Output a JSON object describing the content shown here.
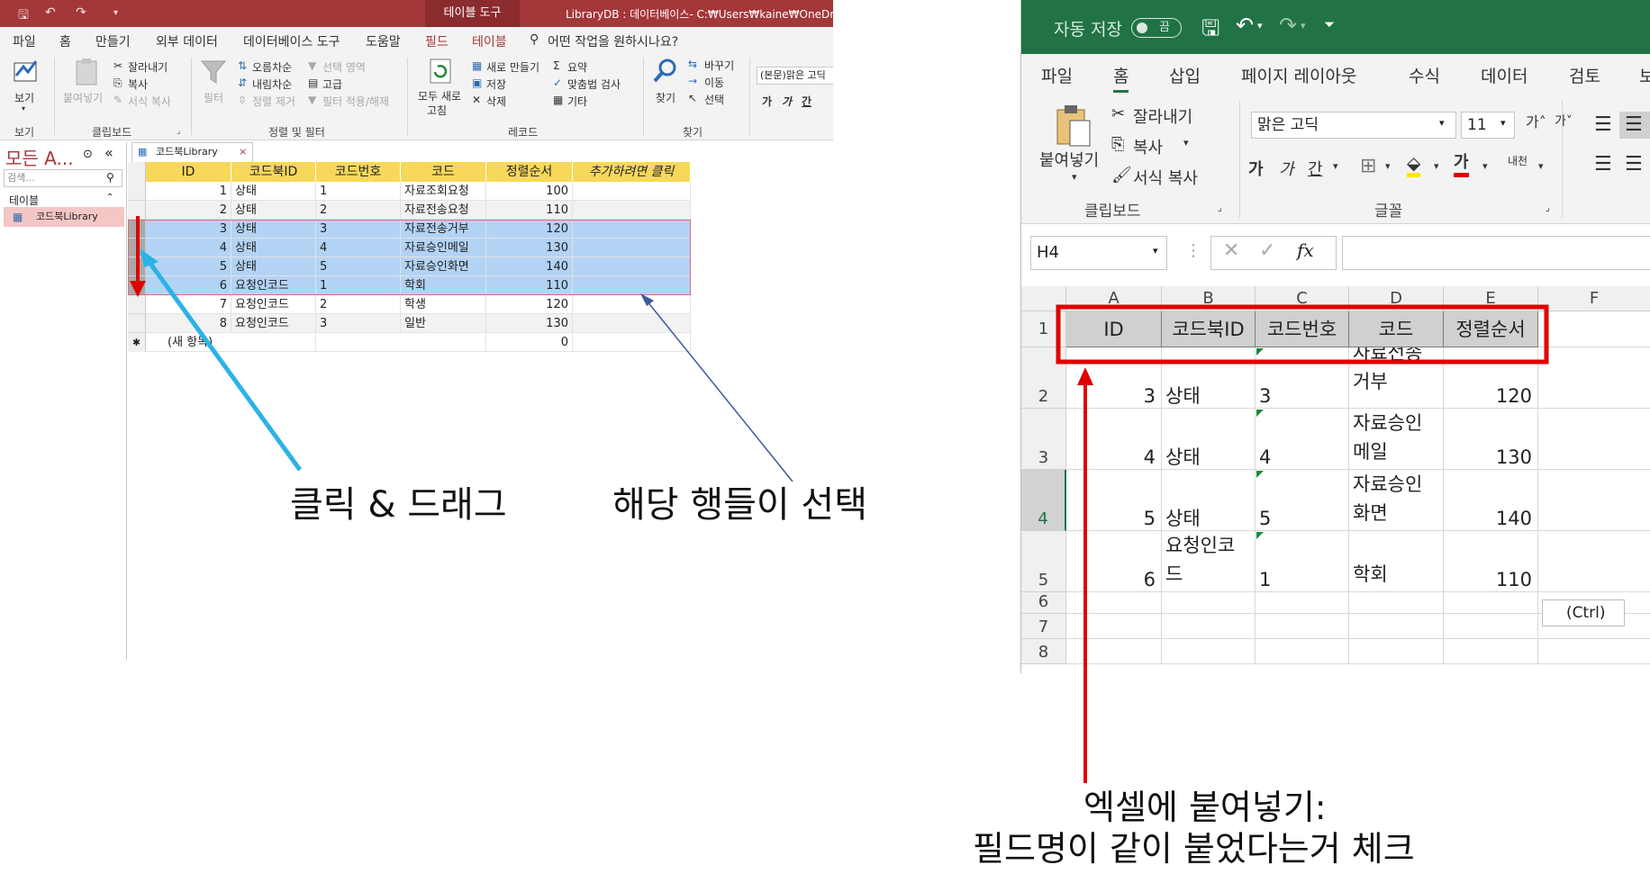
{
  "access": {
    "title": {
      "context_tab": "테이블 도구",
      "document": "LibraryDB : 데이터베이스- C:₩Users₩kaine₩OneDrive₩"
    },
    "tabs": [
      "파일",
      "홈",
      "만들기",
      "외부 데이터",
      "데이터베이스 도구",
      "도움말",
      "필드",
      "테이블"
    ],
    "tell_me": "어떤 작업을 원하시나요?",
    "ribbon": {
      "view": "보기",
      "paste": "붙여넣기",
      "cut": "잘라내기",
      "copy": "복사",
      "format_painter": "서식 복사",
      "filter": "필터",
      "ascending": "오름차순",
      "descending": "내림차순",
      "remove_sort": "정렬 제거",
      "selection": "선택 영역",
      "advanced": "고급",
      "toggle_filter": "필터 적용/해제",
      "refresh_all": "모두 새로",
      "refresh_all2": "고침",
      "new": "새로 만들기",
      "save": "저장",
      "delete": "삭제",
      "totals": "요약",
      "spelling": "맞춤법 검사",
      "more": "기타",
      "find": "찾기",
      "replace": "바꾸기",
      "goto": "이동",
      "select": "선택",
      "font": "(본문)맑은 고딕",
      "group_view": "보기",
      "group_clipboard": "클립보드",
      "group_sort": "정렬 및 필터",
      "group_records": "레코드",
      "group_find": "찾기"
    },
    "nav": {
      "title": "모든 A...",
      "search_placeholder": "검색...",
      "section": "테이블",
      "item": "코드북Library"
    },
    "doc_tab": "코드북Library",
    "columns": [
      "ID",
      "코드북ID",
      "코드번호",
      "코드",
      "정렬순서",
      "추가하려면 클릭"
    ],
    "rows": [
      {
        "id": "1",
        "codebook": "상태",
        "num": "1",
        "code": "자료조회요청",
        "order": "100"
      },
      {
        "id": "2",
        "codebook": "상태",
        "num": "2",
        "code": "자료전송요청",
        "order": "110"
      },
      {
        "id": "3",
        "codebook": "상태",
        "num": "3",
        "code": "자료전송거부",
        "order": "120"
      },
      {
        "id": "4",
        "codebook": "상태",
        "num": "4",
        "code": "자료승인메일",
        "order": "130"
      },
      {
        "id": "5",
        "codebook": "상태",
        "num": "5",
        "code": "자료승인화면",
        "order": "140"
      },
      {
        "id": "6",
        "codebook": "요청인코드",
        "num": "1",
        "code": "학회",
        "order": "110"
      },
      {
        "id": "7",
        "codebook": "요청인코드",
        "num": "2",
        "code": "학생",
        "order": "120"
      },
      {
        "id": "8",
        "codebook": "요청인코드",
        "num": "3",
        "code": "일반",
        "order": "130"
      }
    ],
    "new_row_label": "(새 항목)",
    "new_row_marker": "✱",
    "new_row_order": "0"
  },
  "excel": {
    "autosave": "자동 저장",
    "autosave_state": "끔",
    "tabs": [
      "파일",
      "홈",
      "삽입",
      "페이지 레이아웃",
      "수식",
      "데이터",
      "검토",
      "보"
    ],
    "ribbon": {
      "paste": "붙여넣기",
      "cut": "잘라내기",
      "copy": "복사",
      "format_painter": "서식 복사",
      "font_name": "맑은 고딕",
      "font_size": "11",
      "bold": "가",
      "italic": "가",
      "underline": "간",
      "phonetic": "내천",
      "group_clipboard": "클립보드",
      "group_font": "글꼴"
    },
    "name_box": "H4",
    "fx": "fx",
    "columns": [
      "A",
      "B",
      "C",
      "D",
      "E",
      "F"
    ],
    "row_numbers": [
      "1",
      "2",
      "3",
      "4",
      "5",
      "6",
      "7",
      "8"
    ],
    "header_row": [
      "ID",
      "코드북ID",
      "코드번호",
      "코드",
      "정렬순서"
    ],
    "rows": [
      {
        "id": "3",
        "codebook": "상태",
        "num": "3",
        "code_l1": "자료전송",
        "code_l2": "거부",
        "order": "120"
      },
      {
        "id": "4",
        "codebook": "상태",
        "num": "4",
        "code_l1": "자료승인",
        "code_l2": "메일",
        "order": "130"
      },
      {
        "id": "5",
        "codebook": "상태",
        "num": "5",
        "code_l1": "자료승인",
        "code_l2": "화면",
        "order": "140"
      },
      {
        "id": "6",
        "codebook_l1": "요청인코",
        "codebook_l2": "드",
        "num": "1",
        "code_l1": "",
        "code_l2": "학회",
        "order": "110"
      }
    ],
    "paste_options": "(Ctrl)"
  },
  "annotations": {
    "drag": "클릭 & 드래그",
    "selected": "해당 행들이 선택",
    "paste_line1": "엑셀에 붙여넣기:",
    "paste_line2": "필드명이 같이 붙었다는거 체크"
  },
  "colors": {
    "access_brand": "#a4373a",
    "excel_brand": "#217346",
    "selection": "#b3d3f5",
    "header": "#f8d85a",
    "annotation_red": "#e00000",
    "annotation_blue": "#2ab3e6",
    "annotation_navy": "#3c5a9a"
  }
}
